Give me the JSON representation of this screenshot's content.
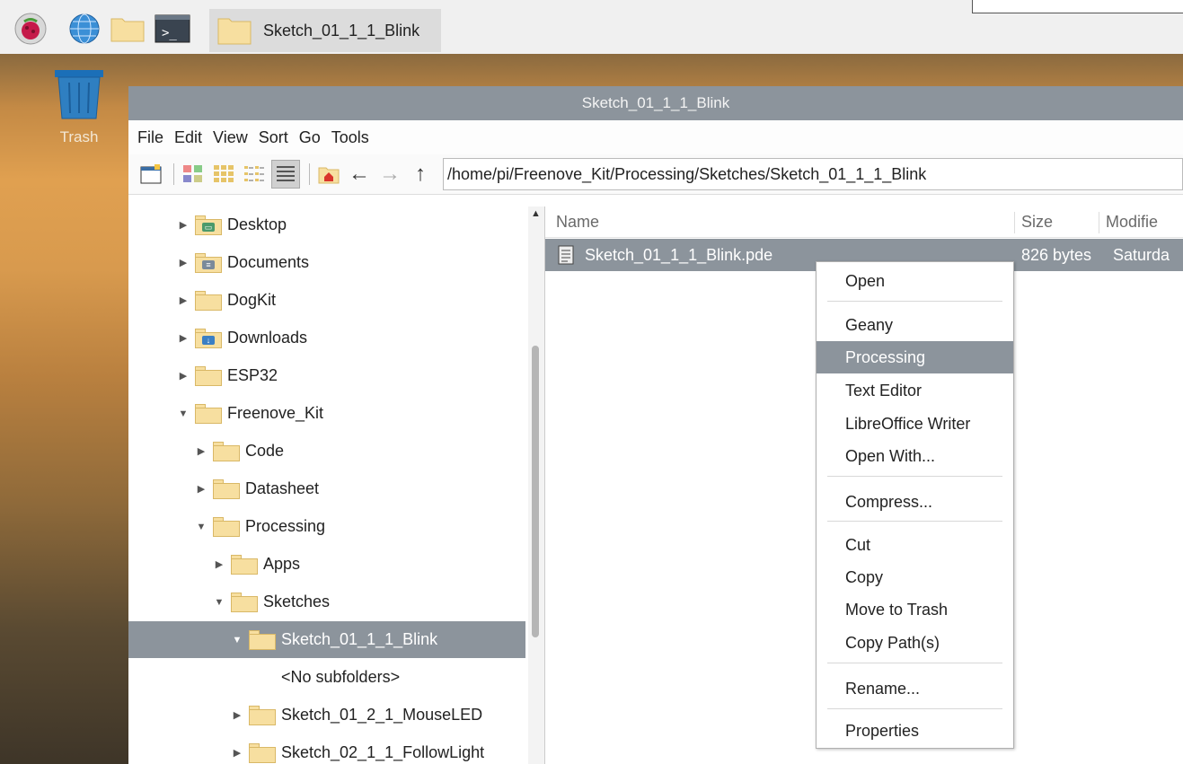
{
  "taskbar": {
    "launcher_icons": [
      "raspberry-icon",
      "globe-icon",
      "folder-icon",
      "terminal-icon"
    ],
    "task_title": "Sketch_01_1_1_Blink"
  },
  "desktop": {
    "trash_label": "Trash"
  },
  "window": {
    "title": "Sketch_01_1_1_Blink",
    "menu": [
      "File",
      "Edit",
      "View",
      "Sort",
      "Go",
      "Tools"
    ],
    "path": "/home/pi/Freenove_Kit/Processing/Sketches/Sketch_01_1_1_Blink"
  },
  "tree": {
    "items": [
      {
        "label": "Desktop",
        "expanded": false
      },
      {
        "label": "Documents",
        "expanded": false
      },
      {
        "label": "DogKit",
        "expanded": false
      },
      {
        "label": "Downloads",
        "expanded": false
      },
      {
        "label": "ESP32",
        "expanded": false
      },
      {
        "label": "Freenove_Kit",
        "expanded": true
      },
      {
        "label": "Code",
        "expanded": false
      },
      {
        "label": "Datasheet",
        "expanded": false
      },
      {
        "label": "Processing",
        "expanded": true
      },
      {
        "label": "Apps",
        "expanded": false
      },
      {
        "label": "Sketches",
        "expanded": true
      },
      {
        "label": "Sketch_01_1_1_Blink",
        "expanded": true,
        "selected": true
      },
      {
        "label": "<No subfolders>"
      },
      {
        "label": "Sketch_01_2_1_MouseLED",
        "expanded": false
      },
      {
        "label": "Sketch_02_1_1_FollowLight",
        "expanded": false
      }
    ]
  },
  "list": {
    "columns": [
      "Name",
      "Size",
      "Modifie"
    ],
    "files": [
      {
        "name": "Sketch_01_1_1_Blink.pde",
        "size": "826 bytes",
        "modified": "Saturda"
      }
    ]
  },
  "context_menu": {
    "items": [
      "Open",
      "Geany",
      "Processing",
      "Text Editor",
      "LibreOffice Writer",
      "Open With...",
      "Compress...",
      "Cut",
      "Copy",
      "Move to Trash",
      "Copy Path(s)",
      "Rename...",
      "Properties"
    ],
    "highlighted": "Processing"
  },
  "colors": {
    "selection": "#8c949c",
    "folder": "#f7dfa0",
    "accent_blue": "#2f7fc1"
  }
}
